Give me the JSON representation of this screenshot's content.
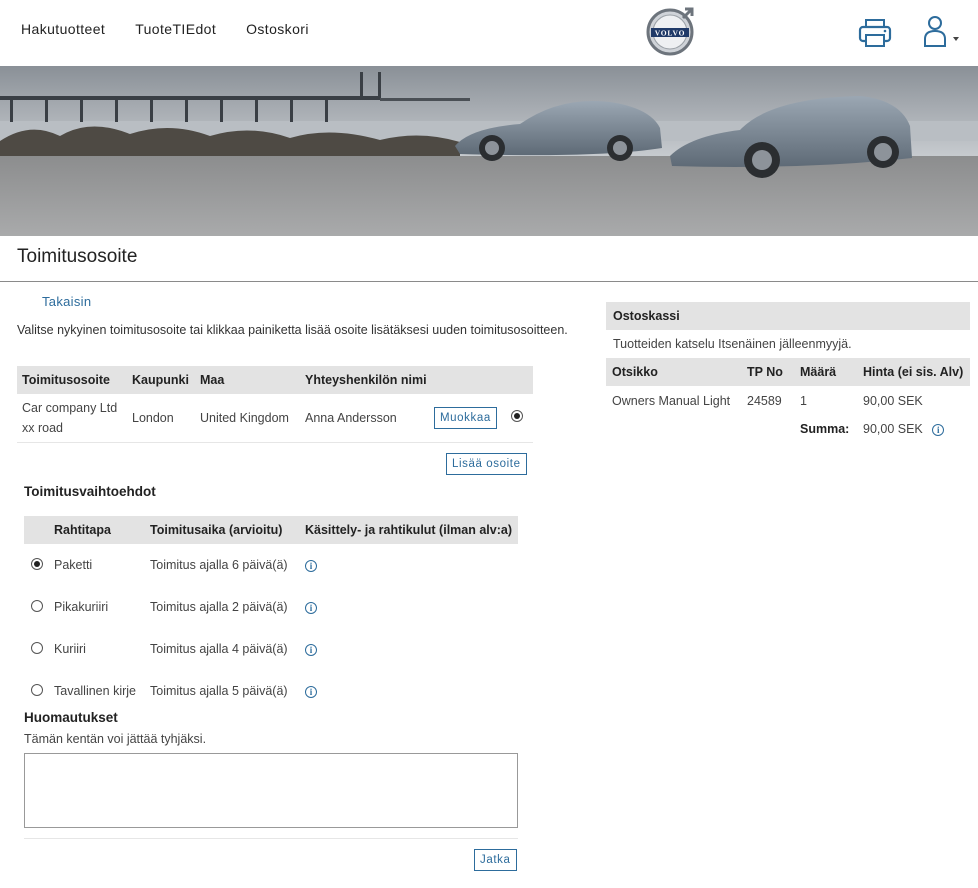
{
  "nav": {
    "items": [
      "Hakutuotteet",
      "TuoteTIEdot",
      "Ostoskori"
    ],
    "logo_text": "VOLVO"
  },
  "page": {
    "title": "Toimitusosoite",
    "back_label": "Takaisin",
    "intro": "Valitse nykyinen toimitusosoite tai klikkaa painiketta lisää osoite lisätäksesi uuden toimitusosoitteen."
  },
  "address_table": {
    "headers": [
      "Toimitusosoite",
      "Kaupunki",
      "Maa",
      "Yhteyshenkilön nimi"
    ],
    "rows": [
      {
        "address_line1": "Car company Ltd",
        "address_line2": "xx road",
        "city": "London",
        "country": "United Kingdom",
        "contact": "Anna Andersson",
        "edit_label": "Muokkaa",
        "selected": true
      }
    ],
    "add_label": "Lisää osoite"
  },
  "delivery": {
    "heading": "Toimitusvaihtoehdot",
    "headers": [
      "Rahtitapa",
      "Toimitusaika (arvioitu)",
      "Käsittely- ja rahtikulut (ilman alv:a)"
    ],
    "options": [
      {
        "method": "Paketti",
        "time": "Toimitus ajalla 6 päivä(ä)",
        "selected": true
      },
      {
        "method": "Pikakuriiri",
        "time": "Toimitus ajalla 2 päivä(ä)",
        "selected": false
      },
      {
        "method": "Kuriiri",
        "time": "Toimitus ajalla 4 päivä(ä)",
        "selected": false
      },
      {
        "method": "Tavallinen kirje",
        "time": "Toimitus ajalla 5 päivä(ä)",
        "selected": false
      }
    ]
  },
  "remarks": {
    "heading": "Huomautukset",
    "hint": "Tämän kentän voi jättää tyhjäksi.",
    "value": ""
  },
  "next_label": "Jatka",
  "cart": {
    "title": "Ostoskassi",
    "subtitle": "Tuotteiden katselu Itsenäinen jälleenmyyjä.",
    "headers": [
      "Otsikko",
      "TP No",
      "Määrä",
      "Hinta (ei sis. Alv)"
    ],
    "items": [
      {
        "title": "Owners Manual Light",
        "tp_no": "24589",
        "qty": "1",
        "price": "90,00 SEK"
      }
    ],
    "sum_label": "Summa:",
    "sum_value": "90,00 SEK"
  },
  "colors": {
    "link": "#2d6c9c",
    "header_bg": "#e3e3e3"
  }
}
